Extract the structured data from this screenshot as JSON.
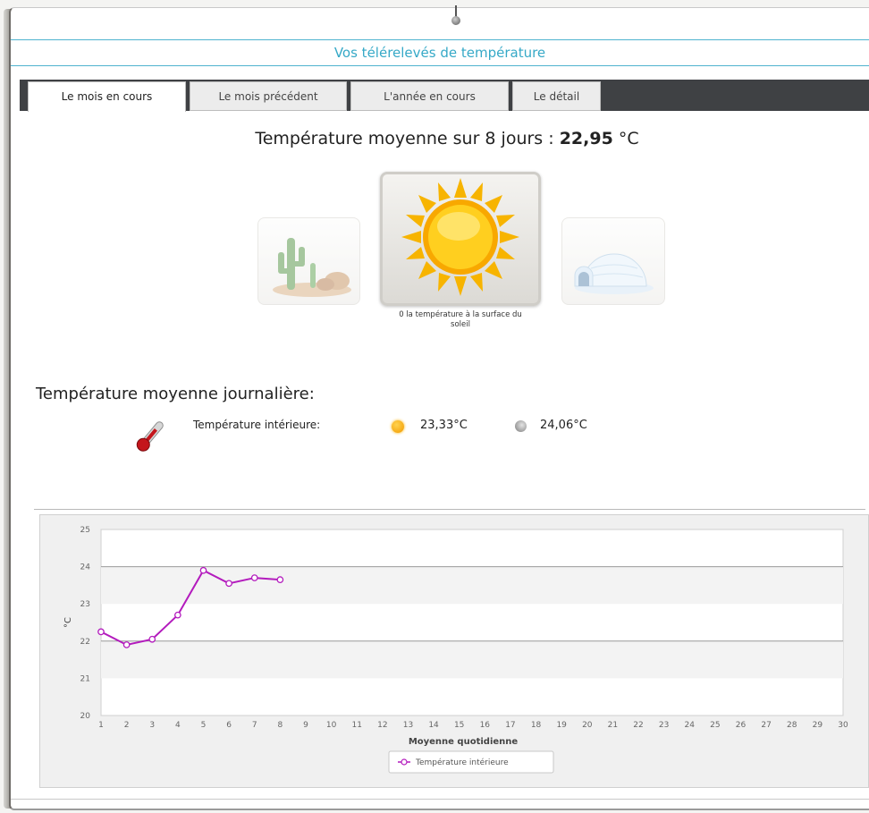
{
  "page": {
    "title": "Vos télérelevés de température"
  },
  "tabs": [
    {
      "label": "Le mois en cours",
      "active": true
    },
    {
      "label": "Le mois précédent",
      "active": false
    },
    {
      "label": "L'année en cours",
      "active": false
    },
    {
      "label": "Le détail",
      "active": false
    }
  ],
  "summary": {
    "prefix": "Température moyenne sur 8 jours :",
    "value": "22,95",
    "unit": "°C"
  },
  "tiles": {
    "left_icon": "cactus-desert-icon",
    "center_icon": "sun-icon",
    "right_icon": "igloo-icon",
    "caption": "0 la température à la surface du soleil"
  },
  "daily": {
    "title": "Température moyenne journalière:",
    "interior_label": "Température intérieure:",
    "day_value": "23,33°C",
    "night_value": "24,06°C",
    "thermometer_icon": "thermometer-icon",
    "day_icon": "sun-icon",
    "night_icon": "moon-icon"
  },
  "chart_data": {
    "type": "line",
    "xlabel": "Moyenne quotidienne",
    "ylabel": "°C",
    "xlim": [
      1,
      30
    ],
    "ylim": [
      20,
      25
    ],
    "y_ticks": [
      20,
      21,
      22,
      23,
      24,
      25
    ],
    "x_ticks": [
      1,
      2,
      3,
      4,
      5,
      6,
      7,
      8,
      9,
      10,
      11,
      12,
      13,
      14,
      15,
      16,
      17,
      18,
      19,
      20,
      21,
      22,
      23,
      24,
      25,
      26,
      27,
      28,
      29,
      30
    ],
    "series": [
      {
        "name": "Température intérieure",
        "color": "#b31bbd",
        "x": [
          1,
          2,
          3,
          4,
          5,
          6,
          7,
          8
        ],
        "values": [
          22.25,
          21.9,
          22.05,
          22.7,
          23.9,
          23.55,
          23.7,
          23.65
        ]
      }
    ],
    "legend": "bottom-center",
    "grid": true
  }
}
